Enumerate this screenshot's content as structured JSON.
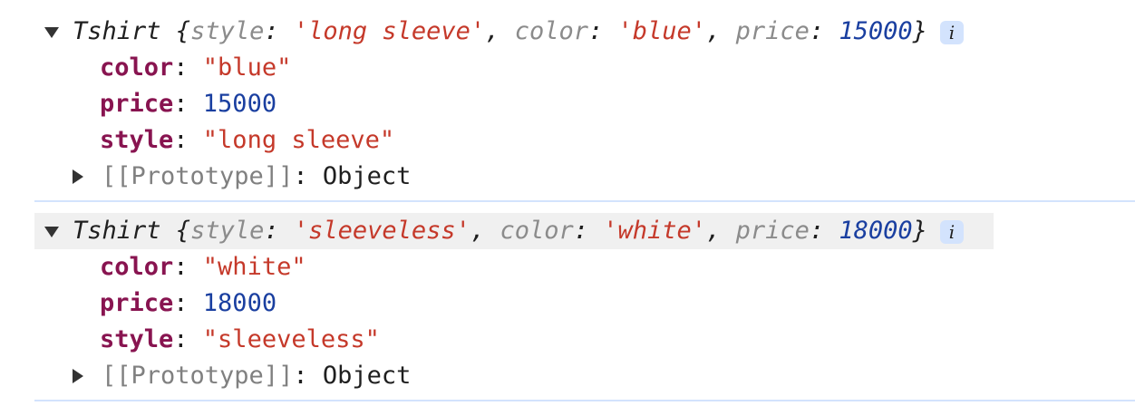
{
  "entries": [
    {
      "class_name": "Tshirt",
      "preview": {
        "style": "'long sleeve'",
        "color": "'blue'",
        "price": "15000"
      },
      "props": [
        {
          "key": "color",
          "value": "\"blue\"",
          "type": "string"
        },
        {
          "key": "price",
          "value": "15000",
          "type": "number"
        },
        {
          "key": "style",
          "value": "\"long sleeve\"",
          "type": "string"
        }
      ],
      "prototype": {
        "key": "[[Prototype]]",
        "value": "Object"
      },
      "info": "i"
    },
    {
      "class_name": "Tshirt",
      "preview": {
        "style": "'sleeveless'",
        "color": "'white'",
        "price": "18000"
      },
      "props": [
        {
          "key": "color",
          "value": "\"white\"",
          "type": "string"
        },
        {
          "key": "price",
          "value": "18000",
          "type": "number"
        },
        {
          "key": "style",
          "value": "\"sleeveless\"",
          "type": "string"
        }
      ],
      "prototype": {
        "key": "[[Prototype]]",
        "value": "Object"
      },
      "info": "i"
    }
  ],
  "labels": {
    "style": "style",
    "color": "color",
    "price": "price"
  }
}
